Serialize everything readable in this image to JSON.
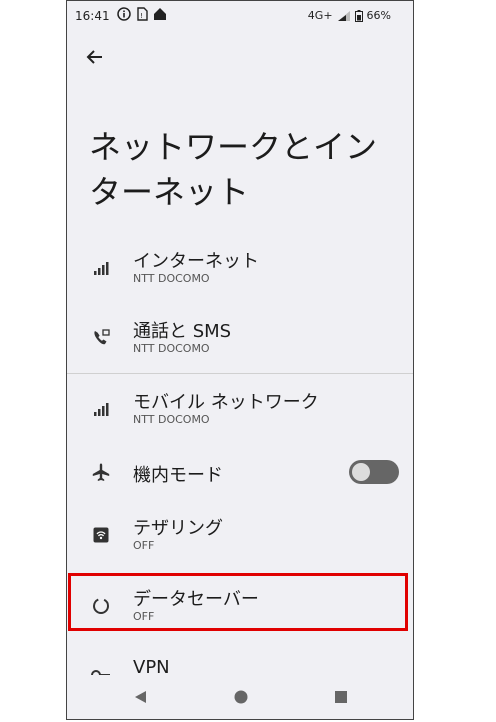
{
  "status": {
    "time": "16:41",
    "network": "4G+",
    "battery": "66%"
  },
  "page_title": "ネットワークとインターネット",
  "items": [
    {
      "label": "インターネット",
      "sub": "NTT DOCOMO",
      "icon": "signal-icon"
    },
    {
      "label": "通話と SMS",
      "sub": "NTT DOCOMO",
      "icon": "call-sms-icon"
    },
    {
      "label": "モバイル ネットワーク",
      "sub": "NTT DOCOMO",
      "icon": "signal-icon"
    },
    {
      "label": "機内モード",
      "icon": "airplane-icon",
      "toggle_on": false
    },
    {
      "label": "テザリング",
      "sub": "OFF",
      "icon": "hotspot-icon"
    },
    {
      "label": "データセーバー",
      "sub": "OFF",
      "icon": "data-saver-icon"
    },
    {
      "label": "VPN",
      "icon": "key-icon"
    }
  ],
  "colors": {
    "highlight": "#e00000",
    "background": "#f0f0f4"
  }
}
